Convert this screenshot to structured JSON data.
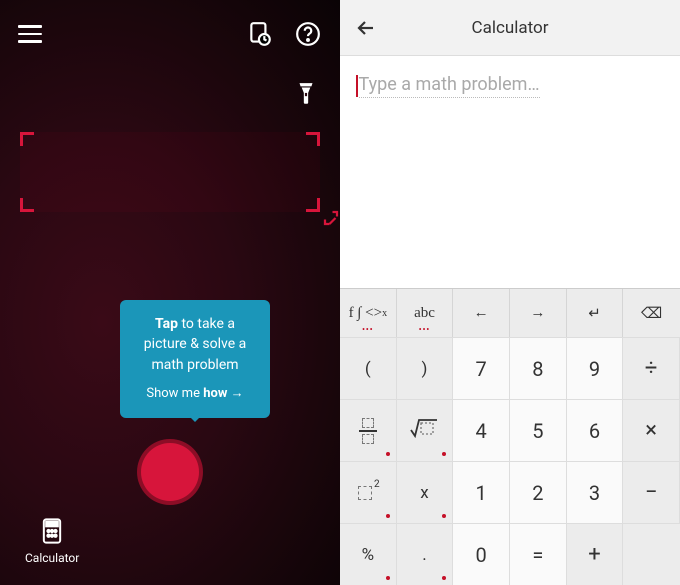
{
  "camera": {
    "tooltip": {
      "tap_bold": "Tap",
      "tap_rest": " to take a picture & solve a math problem",
      "show_pre": "Show me ",
      "show_bold": "how",
      "show_arrow": "→"
    },
    "calculator_label": "Calculator"
  },
  "calculator": {
    "title": "Calculator",
    "input_placeholder": "Type a math problem…",
    "toolbar": {
      "funcs": "f ∫ <>",
      "abc": "abc",
      "left": "←",
      "right": "→",
      "enter": "↵",
      "backspace": "⌫"
    },
    "keys": {
      "r1": {
        "lp": "(",
        "rp": ")",
        "n7": "7",
        "n8": "8",
        "n9": "9",
        "div": "÷"
      },
      "r2": {
        "sqrt": "√",
        "n4": "4",
        "n5": "5",
        "n6": "6",
        "mul": "×"
      },
      "r3": {
        "x": "x",
        "sq": "2",
        "n1": "1",
        "n2": "2",
        "n3": "3",
        "sub": "−"
      },
      "r4": {
        "pct": "%",
        "dot": ".",
        "n0": "0",
        "eq": "=",
        "add": "+"
      }
    }
  }
}
